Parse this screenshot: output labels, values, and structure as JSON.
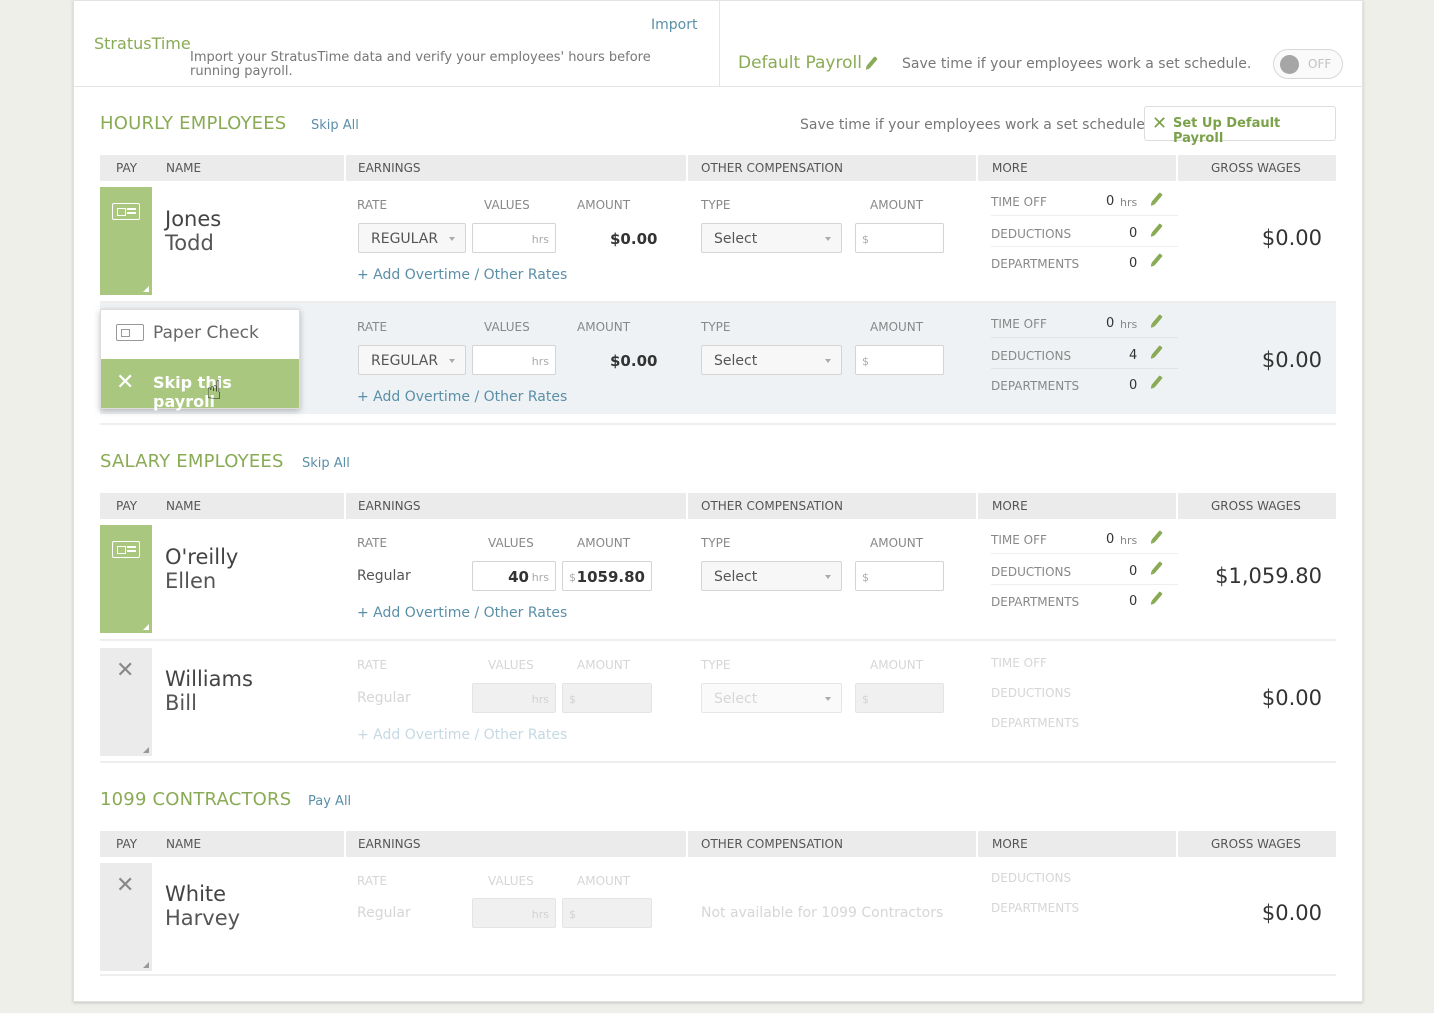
{
  "top": {
    "stratus_title": "StratusTime",
    "import_link": "Import",
    "stratus_desc_1": "Import your StratusTime data and verify your employees' hours before",
    "stratus_desc_2": "running payroll.",
    "default_payroll": "Default Payroll",
    "default_desc": "Save time if your employees work a set schedule.",
    "toggle_label": "OFF"
  },
  "table_headers": {
    "pay": "PAY",
    "name": "NAME",
    "earnings": "EARNINGS",
    "other_comp": "OTHER COMPENSATION",
    "more": "MORE",
    "gross": "GROSS WAGES"
  },
  "col_labels": {
    "rate": "RATE",
    "values": "VALUES",
    "amount": "AMOUNT",
    "type": "TYPE",
    "time_off": "TIME OFF",
    "deductions": "DEDUCTIONS",
    "departments": "DEPARTMENTS",
    "hrs": "hrs",
    "dollar": "$",
    "add_overtime": "+ Add Overtime / Other Rates",
    "select": "Select",
    "not_available": "Not available for 1099 Contractors"
  },
  "hourly": {
    "title": "HOURLY EMPLOYEES",
    "skip_all": "Skip All",
    "hint": "Save time if your employees work a set schedule.",
    "setup_button": "Set Up Default Payroll",
    "rows": [
      {
        "last": "Jones",
        "first": "Todd",
        "rate": "REGULAR",
        "amount": "$0.00",
        "time_off": "0",
        "deductions": "0",
        "departments": "0",
        "gross": "$0.00"
      },
      {
        "rate": "REGULAR",
        "amount": "$0.00",
        "time_off": "0",
        "deductions": "4",
        "departments": "0",
        "gross": "$0.00"
      }
    ]
  },
  "popup": {
    "paper_check": "Paper Check",
    "skip_payroll": "Skip this payroll"
  },
  "salary": {
    "title": "SALARY EMPLOYEES",
    "skip_all": "Skip All",
    "rows": [
      {
        "last": "O'reilly",
        "first": "Ellen",
        "rate": "Regular",
        "values": "40",
        "amount": "1059.80",
        "time_off": "0",
        "deductions": "0",
        "departments": "0",
        "gross": "$1,059.80"
      },
      {
        "last": "Williams",
        "first": "Bill",
        "rate": "Regular",
        "gross": "$0.00"
      }
    ]
  },
  "contractors": {
    "title": "1099 CONTRACTORS",
    "pay_all": "Pay All",
    "rows": [
      {
        "last": "White",
        "first": "Harvey",
        "rate": "Regular",
        "gross": "$0.00"
      }
    ]
  },
  "colors": {
    "accent_green": "#8aab55",
    "pay_green": "#a9c77e",
    "link_blue": "#5a8fa8"
  },
  "icons": [
    "pencil-icon",
    "paper-check-icon",
    "close-icon",
    "tools-icon",
    "dropdown-caret-icon",
    "hand-cursor-icon"
  ]
}
